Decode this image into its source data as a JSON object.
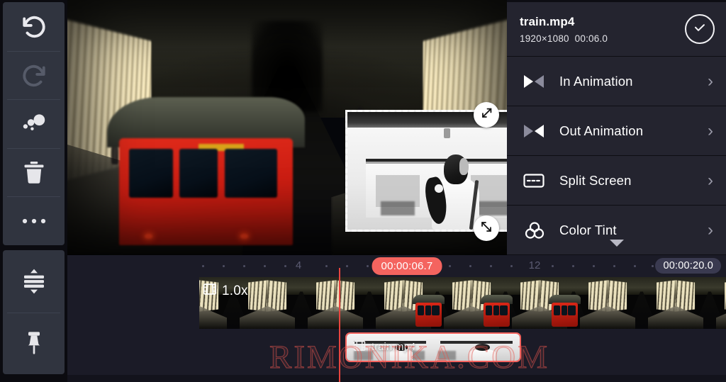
{
  "app": {
    "watermark": "RIMONIKA.COM"
  },
  "sidebar": {
    "items": [
      {
        "name": "undo",
        "label": "Undo",
        "icon": "undo-icon",
        "enabled": true
      },
      {
        "name": "redo",
        "label": "Redo",
        "icon": "redo-icon",
        "enabled": false
      },
      {
        "name": "bubbles",
        "label": "Bubbles",
        "icon": "bubbles-icon",
        "enabled": true
      },
      {
        "name": "delete",
        "label": "Delete",
        "icon": "trash-icon",
        "enabled": true
      },
      {
        "name": "more",
        "label": "More options",
        "icon": "ellipsis-icon",
        "enabled": true
      },
      {
        "name": "expand",
        "label": "Expand track",
        "icon": "expand-rows-icon",
        "enabled": true
      },
      {
        "name": "pin",
        "label": "Pin",
        "icon": "pin-icon",
        "enabled": true
      }
    ]
  },
  "preview": {
    "pip": {
      "selected": true,
      "handles": [
        {
          "name": "rotate-handle",
          "icon": "rotate-arrows-icon"
        },
        {
          "name": "resize-handle",
          "icon": "resize-arrows-icon"
        }
      ]
    }
  },
  "panel": {
    "header": {
      "title": "train.mp4",
      "resolution": "1920×1080",
      "duration": "00:06.0",
      "confirm_icon": "check-circle-icon"
    },
    "items": [
      {
        "label": "In Animation",
        "icon": "in-animation-icon",
        "chevron": "›"
      },
      {
        "label": "Out Animation",
        "icon": "out-animation-icon",
        "chevron": "›"
      },
      {
        "label": "Split Screen",
        "icon": "split-screen-icon",
        "chevron": "›"
      },
      {
        "label": "Color Tint",
        "icon": "color-tint-icon",
        "chevron": "›"
      }
    ],
    "scroll_hint_icon": "chevron-down-icon"
  },
  "timeline": {
    "current_time": "00:00:06.7",
    "total_time": "00:00:20.0",
    "ruler_labels": [
      "4",
      "12"
    ],
    "speed_label": "1.0x",
    "speed_icon": "film-icon",
    "clip": {
      "name": "train.mp4",
      "icon": "film-icon",
      "selected": true
    }
  },
  "colors": {
    "accent_red": "#f4645f",
    "playhead": "#e8453f",
    "panel_bg": "#24242f",
    "timeline_bg": "#1b1b27",
    "sidebar_btn": "#30343f"
  }
}
